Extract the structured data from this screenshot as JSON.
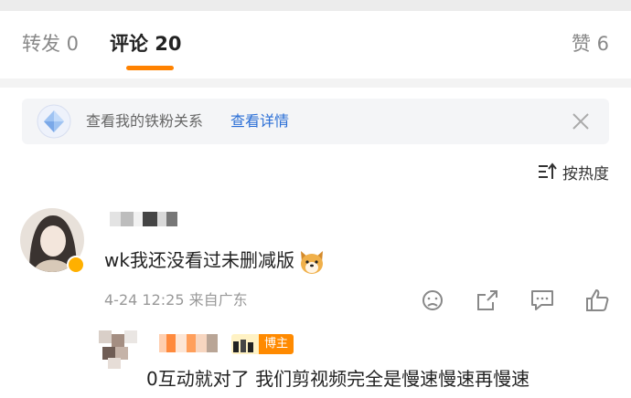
{
  "tabs": {
    "repost": "转发 0",
    "comment": "评论 20",
    "like": "赞 6"
  },
  "fans_bar": {
    "text": "查看我的铁粉关系",
    "link": "查看详情",
    "icon": "diamond-icon",
    "close_icon": "close-icon"
  },
  "sort": {
    "label": "按热度",
    "icon": "sort-icon"
  },
  "comment": {
    "text": "wk我还没看过未删减版",
    "emoji": "dog-emoji-icon",
    "time": "4-24 12:25",
    "location": "来自广东",
    "meta": "4-24 12:25  来自广东",
    "actions": [
      "dislike-face-icon",
      "share-icon",
      "reply-icon",
      "like-icon"
    ]
  },
  "reply": {
    "badge": "博主",
    "text": "0互动就对了 我们剪视频完全是慢速慢速再慢速"
  },
  "colors": {
    "accent": "#ff8200",
    "link": "#2b6fd6",
    "muted": "#999999",
    "badge": "#ff8a00"
  }
}
